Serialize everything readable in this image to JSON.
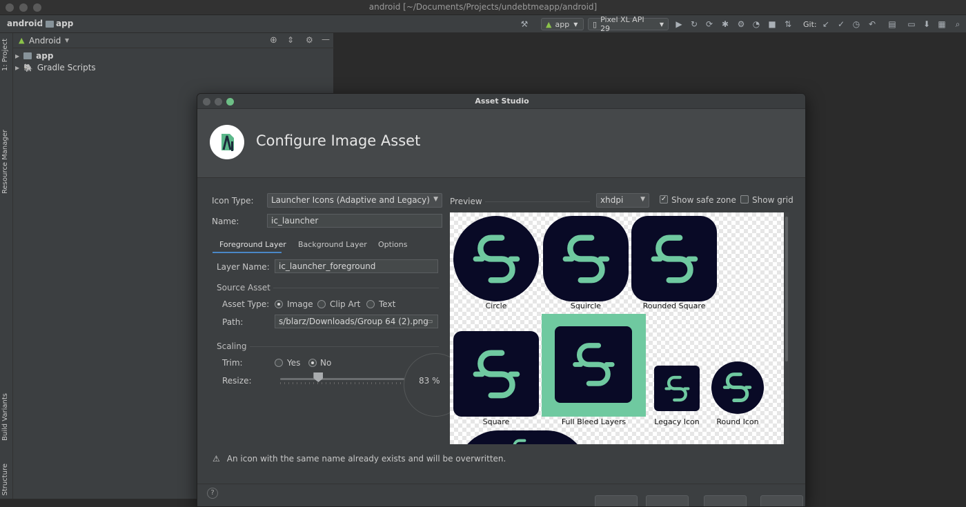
{
  "window": {
    "title": "android [~/Documents/Projects/undebtmeapp/android]"
  },
  "navbar": {
    "crumb_project": "android",
    "crumb_module": "app",
    "run_config": "app",
    "device": "Pixel XL API 29",
    "git_label": "Git:"
  },
  "left_stripe": {
    "project_tab": "1: Project",
    "resource_manager_tab": "Resource Manager",
    "build_variants_tab": "Build Variants",
    "structure_tab": "Structure"
  },
  "project_panel": {
    "view_selector": "Android",
    "tree": [
      {
        "label": "app"
      },
      {
        "label": "Gradle Scripts"
      }
    ]
  },
  "dialog": {
    "title": "Asset Studio",
    "heading": "Configure Image Asset",
    "icon_type_label": "Icon Type:",
    "icon_type_value": "Launcher Icons (Adaptive and Legacy)",
    "name_label": "Name:",
    "name_value": "ic_launcher",
    "tabs": [
      "Foreground Layer",
      "Background Layer",
      "Options"
    ],
    "layer_name_label": "Layer Name:",
    "layer_name_value": "ic_launcher_foreground",
    "source_asset_section": "Source Asset",
    "asset_type_label": "Asset Type:",
    "asset_type_options": [
      "Image",
      "Clip Art",
      "Text"
    ],
    "asset_type_selected": "Image",
    "path_label": "Path:",
    "path_value": "s/blarz/Downloads/Group 64 (2).png",
    "scaling_section": "Scaling",
    "trim_label": "Trim:",
    "trim_options": [
      "Yes",
      "No"
    ],
    "trim_selected": "No",
    "resize_label": "Resize:",
    "resize_value": "83 %",
    "resize_percent": 83,
    "preview_label": "Preview",
    "density_value": "xhdpi",
    "show_safe_zone_label": "Show safe zone",
    "show_safe_zone_checked": true,
    "show_grid_label": "Show grid",
    "show_grid_checked": false,
    "preview_captions": [
      "Circle",
      "Squircle",
      "Rounded Square",
      "Square",
      "Full Bleed Layers",
      "Legacy Icon",
      "Round Icon"
    ],
    "warning": "An icon with the same name already exists and will be overwritten."
  },
  "colors": {
    "icon_bg": "#090a26",
    "icon_fg": "#6fc9a0",
    "full_bleed_bg": "#6fc9a0",
    "selection": "#4a88c7"
  }
}
